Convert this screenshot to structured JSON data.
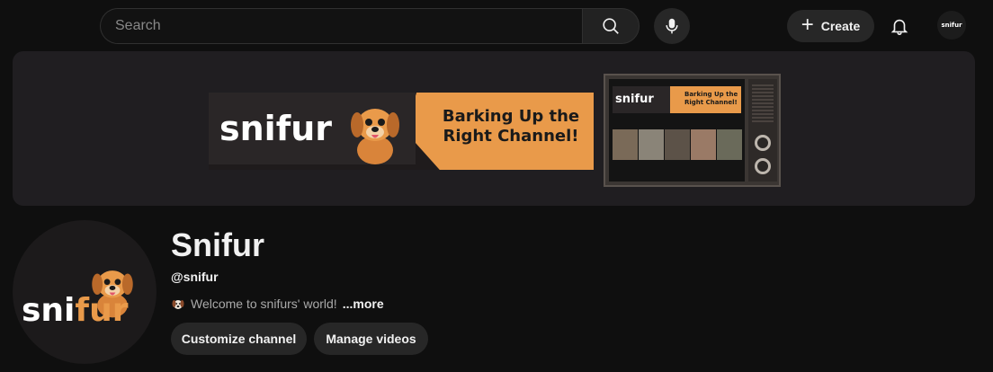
{
  "header": {
    "search_placeholder": "Search",
    "create_label": "Create",
    "avatar_text": "snifur"
  },
  "banner": {
    "art_logo": "snifur",
    "art_tagline": "Barking Up the Right Channel!",
    "tv_logo": "snifur",
    "tv_tagline": "Barking Up the Right Channel!"
  },
  "channel": {
    "avatar_logo_a": "sni",
    "avatar_logo_b": "fur",
    "title": "Snifur",
    "handle": "@snifur",
    "description": "Welcome to snifurs' world!",
    "more_label": "...more",
    "customize_label": "Customize channel",
    "manage_label": "Manage videos"
  },
  "colors": {
    "background": "#0f0f0f",
    "banner_bg": "#201e21",
    "accent_orange": "#e99a4a",
    "button_bg": "#272727"
  }
}
